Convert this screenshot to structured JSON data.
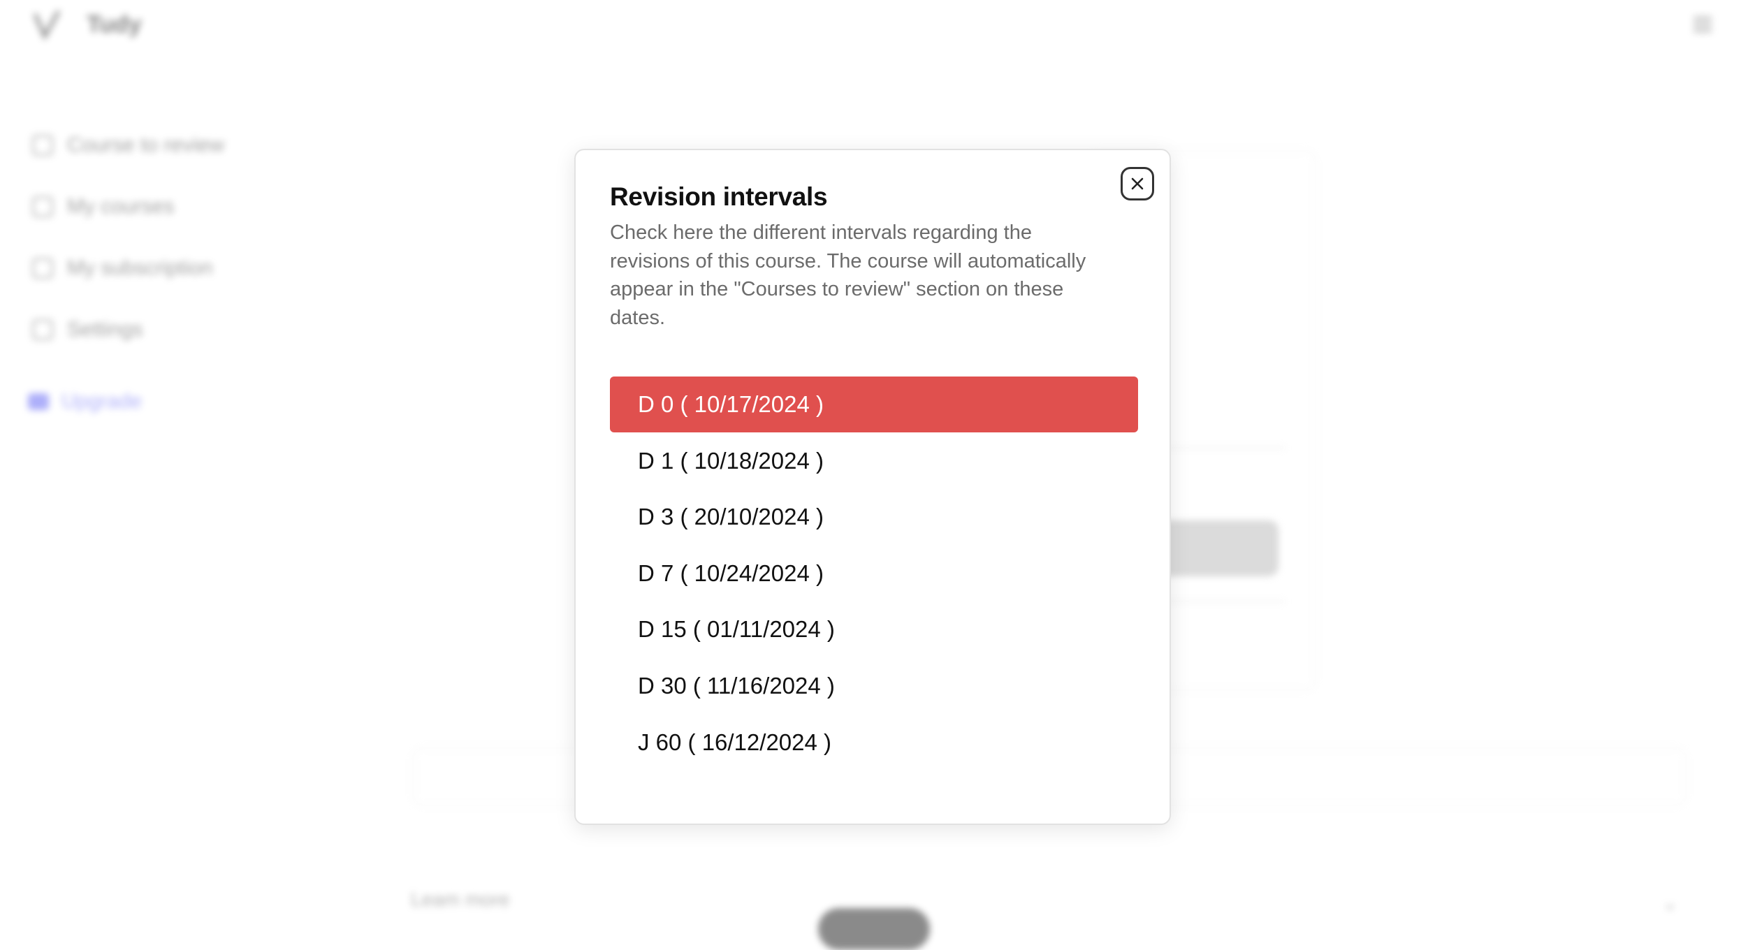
{
  "app": {
    "title": "Tudy",
    "nav": [
      {
        "label": "Course to review",
        "icon": "clock-icon"
      },
      {
        "label": "My courses",
        "icon": "book-icon"
      },
      {
        "label": "My subscription",
        "icon": "card-icon"
      },
      {
        "label": "Settings",
        "icon": "gear-icon"
      }
    ],
    "upgrade_label": "Upgrade",
    "footer_label": "Leam more"
  },
  "modal": {
    "title": "Revision intervals",
    "description": "Check here the different intervals regarding the revisions of this course. The course will automatically appear in the \"Courses to review\" section on these dates.",
    "close_icon": "close-icon",
    "intervals": [
      {
        "label": "D 0 ( 10/17/2024 )",
        "active": true
      },
      {
        "label": "D 1 ( 10/18/2024 )",
        "active": false
      },
      {
        "label": "D 3 ( 20/10/2024 )",
        "active": false
      },
      {
        "label": "D 7 ( 10/24/2024 )",
        "active": false
      },
      {
        "label": "D 15 ( 01/11/2024 )",
        "active": false
      },
      {
        "label": "D 30 ( 11/16/2024 )",
        "active": false
      },
      {
        "label": "J 60 ( 16/12/2024 )",
        "active": false
      }
    ]
  },
  "colors": {
    "active_interval": "#e0504e",
    "upgrade_accent": "#6b6ef5"
  }
}
